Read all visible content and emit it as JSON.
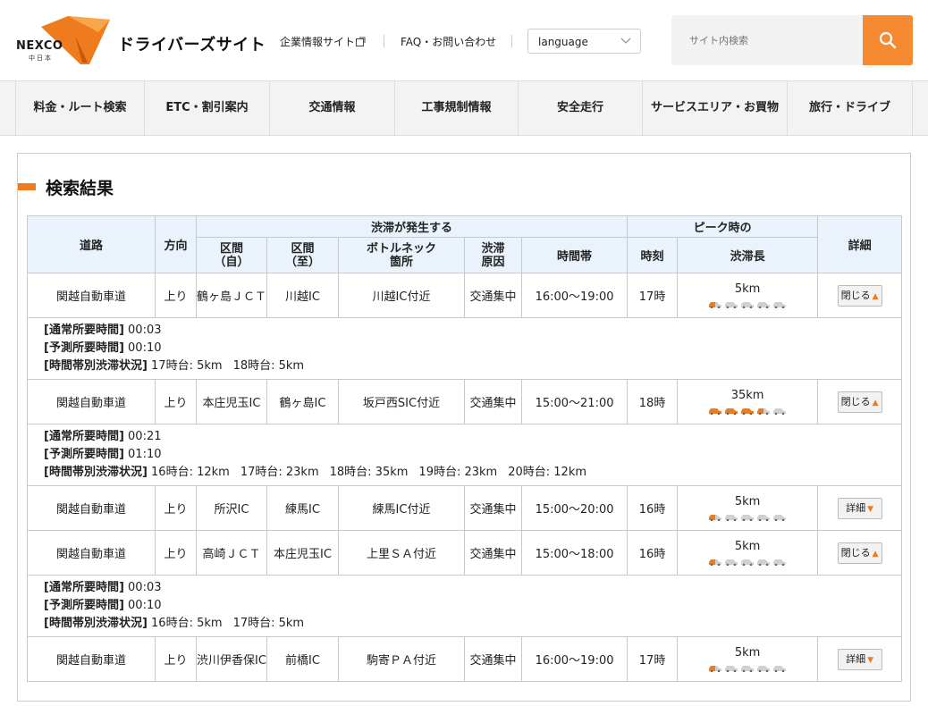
{
  "header": {
    "logo_text": "NEXCO",
    "logo_sub": "中日本",
    "site_title": "ドライバーズサイト",
    "links": [
      "企業情報サイト",
      "FAQ・お問い合わせ"
    ],
    "language_label": "language",
    "search_placeholder": "サイト内検索"
  },
  "nav": [
    "料金・ルート検索",
    "ETC・割引案内",
    "交通情報",
    "工事規制情報",
    "安全走行",
    "サービスエリア・お買物",
    "旅行・ドライブ"
  ],
  "main": {
    "title": "検索結果",
    "table_headers": {
      "road": "道路",
      "direction": "方向",
      "group_jam": "渋滞が発生する",
      "section_from": "区間\n（自）",
      "section_to": "区間\n（至）",
      "bottleneck": "ボトルネック\n箇所",
      "cause": "渋滞\n原因",
      "timeslot": "時間帯",
      "group_peak": "ピーク時の",
      "peak_time": "時刻",
      "peak_length": "渋滞長",
      "detail": "詳細"
    },
    "rows": [
      {
        "road": "関越自動車道",
        "direction": "上り",
        "from": "鶴ヶ島ＪＣＴ",
        "to": "川越IC",
        "bottleneck": "川越IC付近",
        "cause": "交通集中",
        "timeslot": "16:00～19:00",
        "peak_time": "17時",
        "peak_length": "5km",
        "cars_full": 0,
        "cars_half": 1,
        "button": "閉じる",
        "button_icon": "▲",
        "detail": {
          "normal_label": "[通常所要時間]",
          "normal": "00:03",
          "predicted_label": "[予測所要時間]",
          "predicted": "00:10",
          "hourly_label": "[時間帯別渋滞状況]",
          "hourly": [
            "17時台: 5km",
            "18時台: 5km"
          ]
        }
      },
      {
        "road": "関越自動車道",
        "direction": "上り",
        "from": "本庄児玉IC",
        "to": "鶴ヶ島IC",
        "bottleneck": "坂戸西SIC付近",
        "cause": "交通集中",
        "timeslot": "15:00～21:00",
        "peak_time": "18時",
        "peak_length": "35km",
        "cars_full": 3,
        "cars_half": 1,
        "button": "閉じる",
        "button_icon": "▲",
        "detail": {
          "normal_label": "[通常所要時間]",
          "normal": "00:21",
          "predicted_label": "[予測所要時間]",
          "predicted": "01:10",
          "hourly_label": "[時間帯別渋滞状況]",
          "hourly": [
            "16時台: 12km",
            "17時台: 23km",
            "18時台: 35km",
            "19時台: 23km",
            "20時台: 12km"
          ]
        }
      },
      {
        "road": "関越自動車道",
        "direction": "上り",
        "from": "所沢IC",
        "to": "練馬IC",
        "bottleneck": "練馬IC付近",
        "cause": "交通集中",
        "timeslot": "15:00～20:00",
        "peak_time": "16時",
        "peak_length": "5km",
        "cars_full": 0,
        "cars_half": 1,
        "button": "詳細",
        "button_icon": "▼",
        "detail": null
      },
      {
        "road": "関越自動車道",
        "direction": "上り",
        "from": "高崎ＪＣＴ",
        "to": "本庄児玉IC",
        "bottleneck": "上里ＳＡ付近",
        "cause": "交通集中",
        "timeslot": "15:00～18:00",
        "peak_time": "16時",
        "peak_length": "5km",
        "cars_full": 0,
        "cars_half": 1,
        "button": "閉じる",
        "button_icon": "▲",
        "detail": {
          "normal_label": "[通常所要時間]",
          "normal": "00:03",
          "predicted_label": "[予測所要時間]",
          "predicted": "00:10",
          "hourly_label": "[時間帯別渋滞状況]",
          "hourly": [
            "16時台: 5km",
            "17時台: 5km"
          ]
        }
      },
      {
        "road": "関越自動車道",
        "direction": "上り",
        "from": "渋川伊香保IC",
        "to": "前橋IC",
        "bottleneck": "駒寄ＰＡ付近",
        "cause": "交通集中",
        "timeslot": "16:00～19:00",
        "peak_time": "17時",
        "peak_length": "5km",
        "cars_full": 0,
        "cars_half": 1,
        "button": "詳細",
        "button_icon": "▼",
        "detail": null
      }
    ]
  },
  "colors": {
    "accent": "#f58a33",
    "header_bg": "#eaf3fc",
    "car_active": "#ee7b1e",
    "car_inactive": "#d0d0d0"
  },
  "icons": {
    "search": "search-icon",
    "external": "external-link-icon",
    "chevron": "chevron-down-icon",
    "car": "car-icon"
  }
}
